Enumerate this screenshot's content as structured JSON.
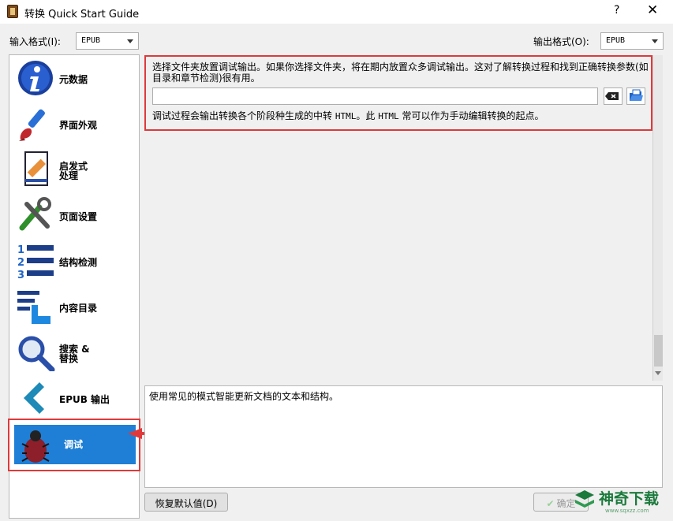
{
  "window": {
    "title": "转换 Quick Start Guide",
    "help_glyph": "?",
    "close_glyph": "✕"
  },
  "formats": {
    "input_label": "输入格式(I):",
    "input_value": "EPUB",
    "output_label": "输出格式(O):",
    "output_value": "EPUB"
  },
  "sidebar": {
    "items": [
      {
        "label": "元数据",
        "icon": "info-icon"
      },
      {
        "label": "界面外观",
        "icon": "paintbrush-icon"
      },
      {
        "label": "启发式\n处理",
        "icon": "document-icon"
      },
      {
        "label": "页面设置",
        "icon": "tools-icon"
      },
      {
        "label": "结构检测",
        "icon": "numbered-list-icon"
      },
      {
        "label": "内容目录",
        "icon": "toc-icon"
      },
      {
        "label": "搜索 &\n替换",
        "icon": "magnifier-icon"
      },
      {
        "label": "EPUB 输出",
        "icon": "chevron-left-icon"
      },
      {
        "label": "调试",
        "icon": "bug-icon",
        "selected": true
      }
    ]
  },
  "debug": {
    "description": "选择文件夹放置调试输出。如果你选择文件夹，将在期内放置众多调试输出。这对了解转换过程和找到正确转换参数(如目录和章节检测)很有用。",
    "path_value": "",
    "note_prefix": "调试过程会输出转换各个阶段种生成的中转",
    "note_mono1": "HTML",
    "note_middle": "。此",
    "note_mono2": "HTML",
    "note_suffix": "常可以作为手动编辑转换的起点。"
  },
  "help_text": "使用常见的模式智能更新文档的文本和结构。",
  "buttons": {
    "restore_defaults": "恢复默认值(D)",
    "ok": "确定"
  },
  "watermark": {
    "text": "神奇下载",
    "sub": "www.sqxzz.com"
  },
  "colors": {
    "accent": "#1f7fd6",
    "annotation": "#e0393b"
  }
}
